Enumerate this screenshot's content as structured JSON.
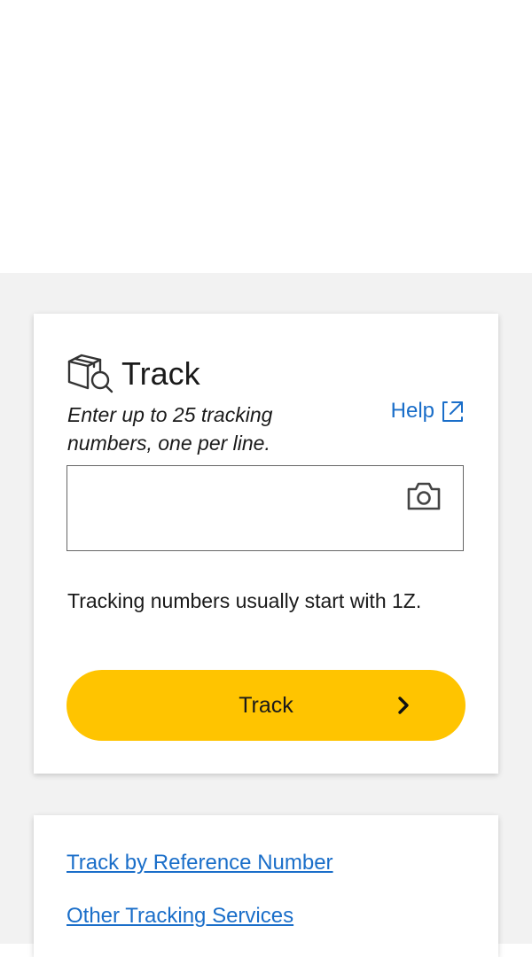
{
  "track_card": {
    "title": "Track",
    "instructions": "Enter up to 25 tracking numbers, one per line.",
    "help_label": "Help",
    "input_value": "",
    "hint": "Tracking numbers usually start with 1Z.",
    "button_label": "Track",
    "icons": {
      "title": "package-search-icon",
      "help": "external-link-icon",
      "camera": "camera-icon",
      "button": "chevron-right-icon"
    }
  },
  "links": [
    {
      "label": "Track by Reference Number"
    },
    {
      "label": "Other Tracking Services"
    }
  ],
  "colors": {
    "accent_button": "#ffc400",
    "link": "#1a6ec9",
    "page_background": "#f2f2f2"
  }
}
